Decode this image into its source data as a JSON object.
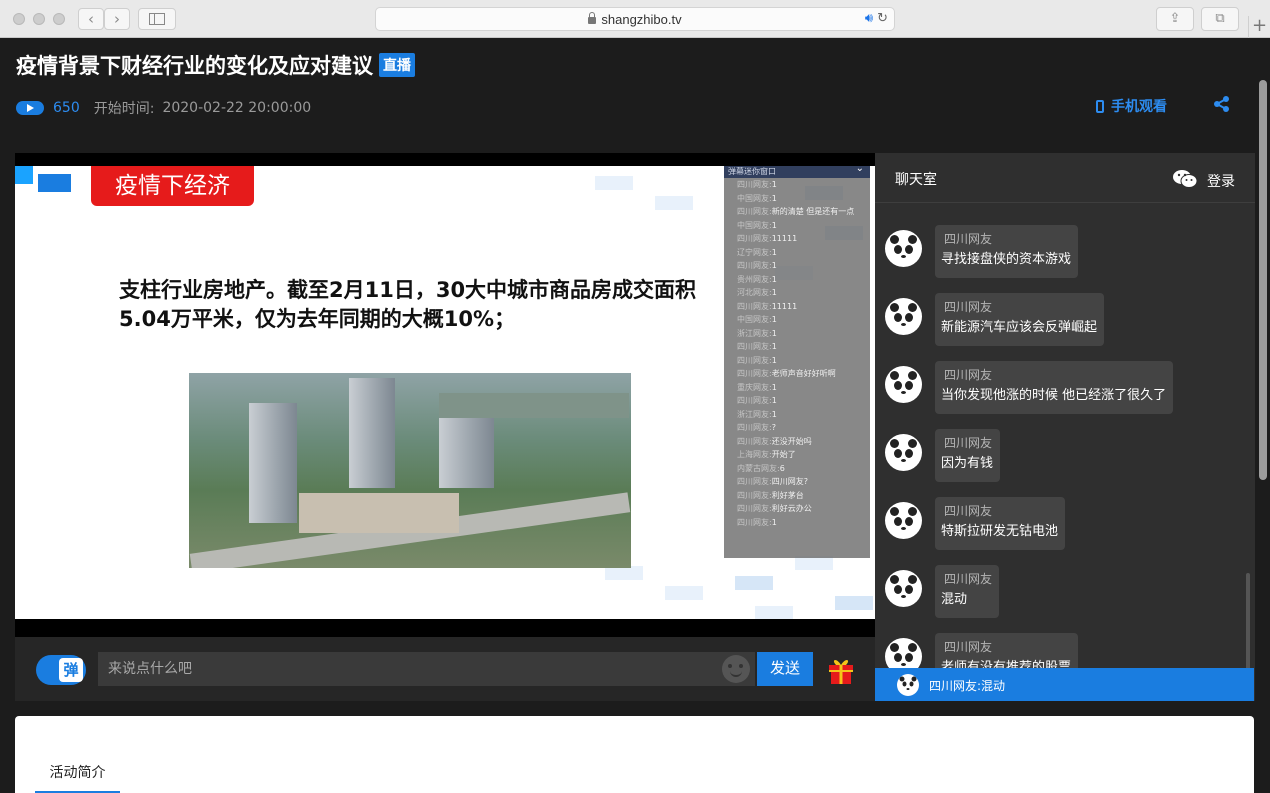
{
  "browser": {
    "url": "shangzhibo.tv"
  },
  "header": {
    "title": "疫情背景下财经行业的变化及应对建议",
    "live_badge": "直播",
    "view_count": "650",
    "start_label": "开始时间:",
    "start_time": "2020-02-22 20:00:00",
    "mobile_watch": "手机观看"
  },
  "slide": {
    "tag": "疫情下经济",
    "text": "支柱行业房地产。截至2月11日，30大中城市商品房成交面积5.04万平米，仅为去年同期的大概10%；"
  },
  "overlay": {
    "title": "弹幕迷你窗口",
    "lines": [
      {
        "user": "四川网友:",
        "text": "1"
      },
      {
        "user": "中国网友:",
        "text": "1"
      },
      {
        "user": "四川网友:",
        "text": "新的清楚 但是还有一点"
      },
      {
        "user": "中国网友:",
        "text": "1"
      },
      {
        "user": "四川网友:",
        "text": "11111"
      },
      {
        "user": "辽宁网友:",
        "text": "1"
      },
      {
        "user": "四川网友:",
        "text": "1"
      },
      {
        "user": "贵州网友:",
        "text": "1"
      },
      {
        "user": "河北网友:",
        "text": "1"
      },
      {
        "user": "四川网友:",
        "text": "11111"
      },
      {
        "user": "中国网友:",
        "text": "1"
      },
      {
        "user": "浙江网友:",
        "text": "1"
      },
      {
        "user": "四川网友:",
        "text": "1"
      },
      {
        "user": "四川网友:",
        "text": "1"
      },
      {
        "user": "四川网友:",
        "text": "老师声音好好听啊"
      },
      {
        "user": "重庆网友:",
        "text": "1"
      },
      {
        "user": "四川网友:",
        "text": "1"
      },
      {
        "user": "浙江网友:",
        "text": "1"
      },
      {
        "user": "四川网友:",
        "text": "?"
      },
      {
        "user": "四川网友:",
        "text": "还没开始吗"
      },
      {
        "user": "上海网友:",
        "text": "开始了"
      },
      {
        "user": "内蒙古网友:",
        "text": "6"
      },
      {
        "user": "四川网友:",
        "text": "四川网友?"
      },
      {
        "user": "四川网友:",
        "text": "利好茅台"
      },
      {
        "user": "四川网友:",
        "text": "利好云办公"
      },
      {
        "user": "四川网友:",
        "text": "1"
      }
    ]
  },
  "input_bar": {
    "danmu_label": "弹",
    "placeholder": "来说点什么吧",
    "send_label": "发送"
  },
  "chat": {
    "title": "聊天室",
    "login_label": "登录",
    "messages": [
      {
        "user": "四川网友",
        "text": "寻找接盘侠的资本游戏"
      },
      {
        "user": "四川网友",
        "text": "新能源汽车应该会反弹崛起"
      },
      {
        "user": "四川网友",
        "text": "当你发现他涨的时候 他已经涨了很久了"
      },
      {
        "user": "四川网友",
        "text": "因为有钱"
      },
      {
        "user": "四川网友",
        "text": "特斯拉研发无钴电池"
      },
      {
        "user": "四川网友",
        "text": "混动"
      },
      {
        "user": "四川网友",
        "text": "老师有没有推荐的股票"
      }
    ],
    "notice": "四川网友:混动"
  },
  "info": {
    "tab_intro": "活动简介"
  },
  "colors": {
    "accent": "#1a7de0",
    "badge_red": "#e61b1b",
    "background": "#1c1c1c"
  }
}
